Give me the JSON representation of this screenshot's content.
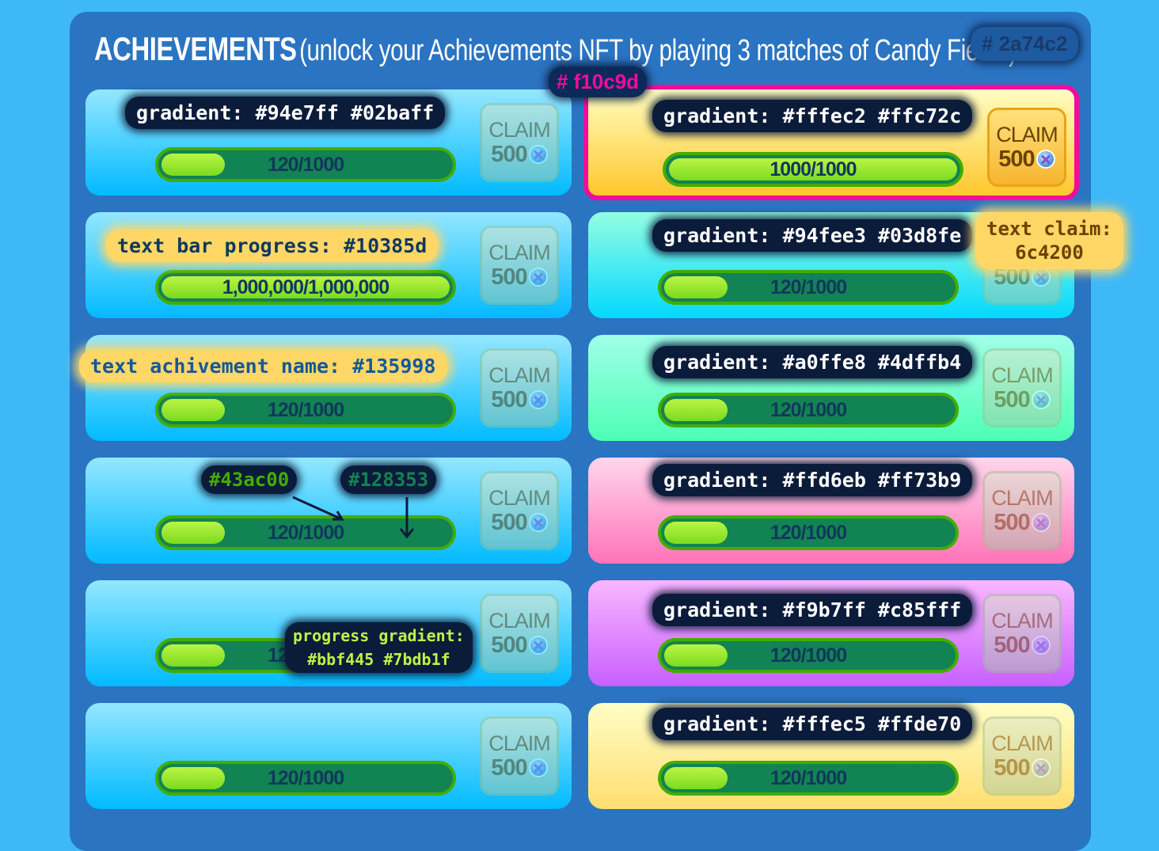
{
  "header": {
    "title": "ACHIEVEMENTS",
    "subtitle": "(unlock your Achievements NFT by playing 3 matches of Candy Fiesta)"
  },
  "claim": {
    "label": "CLAIM",
    "amount": "500"
  },
  "cards": [
    {
      "bg": "linear-gradient(#94e7ff,#02baff)",
      "progress": "120/1000",
      "fill": 0.12,
      "claimable": false
    },
    {
      "bg": "linear-gradient(#fffec2,#ffc72c)",
      "progress": "1000/1000",
      "fill": 1.0,
      "claimable": true
    },
    {
      "bg": "linear-gradient(#94e7ff,#02baff)",
      "progress": "1,000,000/1,000,000",
      "fill": 1.0,
      "claimable": false
    },
    {
      "bg": "linear-gradient(#94fee3,#03d8fe)",
      "progress": "120/1000",
      "fill": 0.12,
      "claimable": false
    },
    {
      "bg": "linear-gradient(#94e7ff,#02baff)",
      "progress": "120/1000",
      "fill": 0.12,
      "claimable": false
    },
    {
      "bg": "linear-gradient(#a0ffe8,#4dffb4)",
      "progress": "120/1000",
      "fill": 0.12,
      "claimable": false
    },
    {
      "bg": "linear-gradient(#94e7ff,#02baff)",
      "progress": "120/1000",
      "fill": 0.12,
      "claimable": false
    },
    {
      "bg": "linear-gradient(#ffd6eb,#ff73b9)",
      "progress": "120/1000",
      "fill": 0.12,
      "claimable": false
    },
    {
      "bg": "linear-gradient(#94e7ff,#02baff)",
      "progress": "120/1000",
      "fill": 0.12,
      "claimable": false
    },
    {
      "bg": "linear-gradient(#f9b7ff,#c85fff)",
      "progress": "120/1000",
      "fill": 0.12,
      "claimable": false
    },
    {
      "bg": "linear-gradient(#94e7ff,#02baff)",
      "progress": "120/1000",
      "fill": 0.12,
      "claimable": false
    },
    {
      "bg": "linear-gradient(#fffec5,#ffde70)",
      "progress": "120/1000",
      "fill": 0.12,
      "claimable": false
    }
  ],
  "annotations": {
    "panel_color": "# 2a74c2",
    "border_color": "# f10c9d",
    "card1": "gradient: #94e7ff  #02baff",
    "card2": "gradient: #fffec2  #ffc72c",
    "card4": "gradient: #94fee3  #03d8fe",
    "card6": "gradient: #a0ffe8  #4dffb4",
    "card8": "gradient: #ffd6eb  #ff73b9",
    "card10": "gradient: #f9b7ff  #c85fff",
    "card12": "gradient: #fffec5  #ffde70",
    "text_bar_progress": "text bar progress: #10385d",
    "text_achievement_name": "text achivement name: #135998",
    "text_claim": "text claim:\n6c4200",
    "bar_border": "#43ac00",
    "bar_bg": "#128353",
    "progress_gradient": "progress gradient:\n#bbf445 #7bdb1f"
  }
}
